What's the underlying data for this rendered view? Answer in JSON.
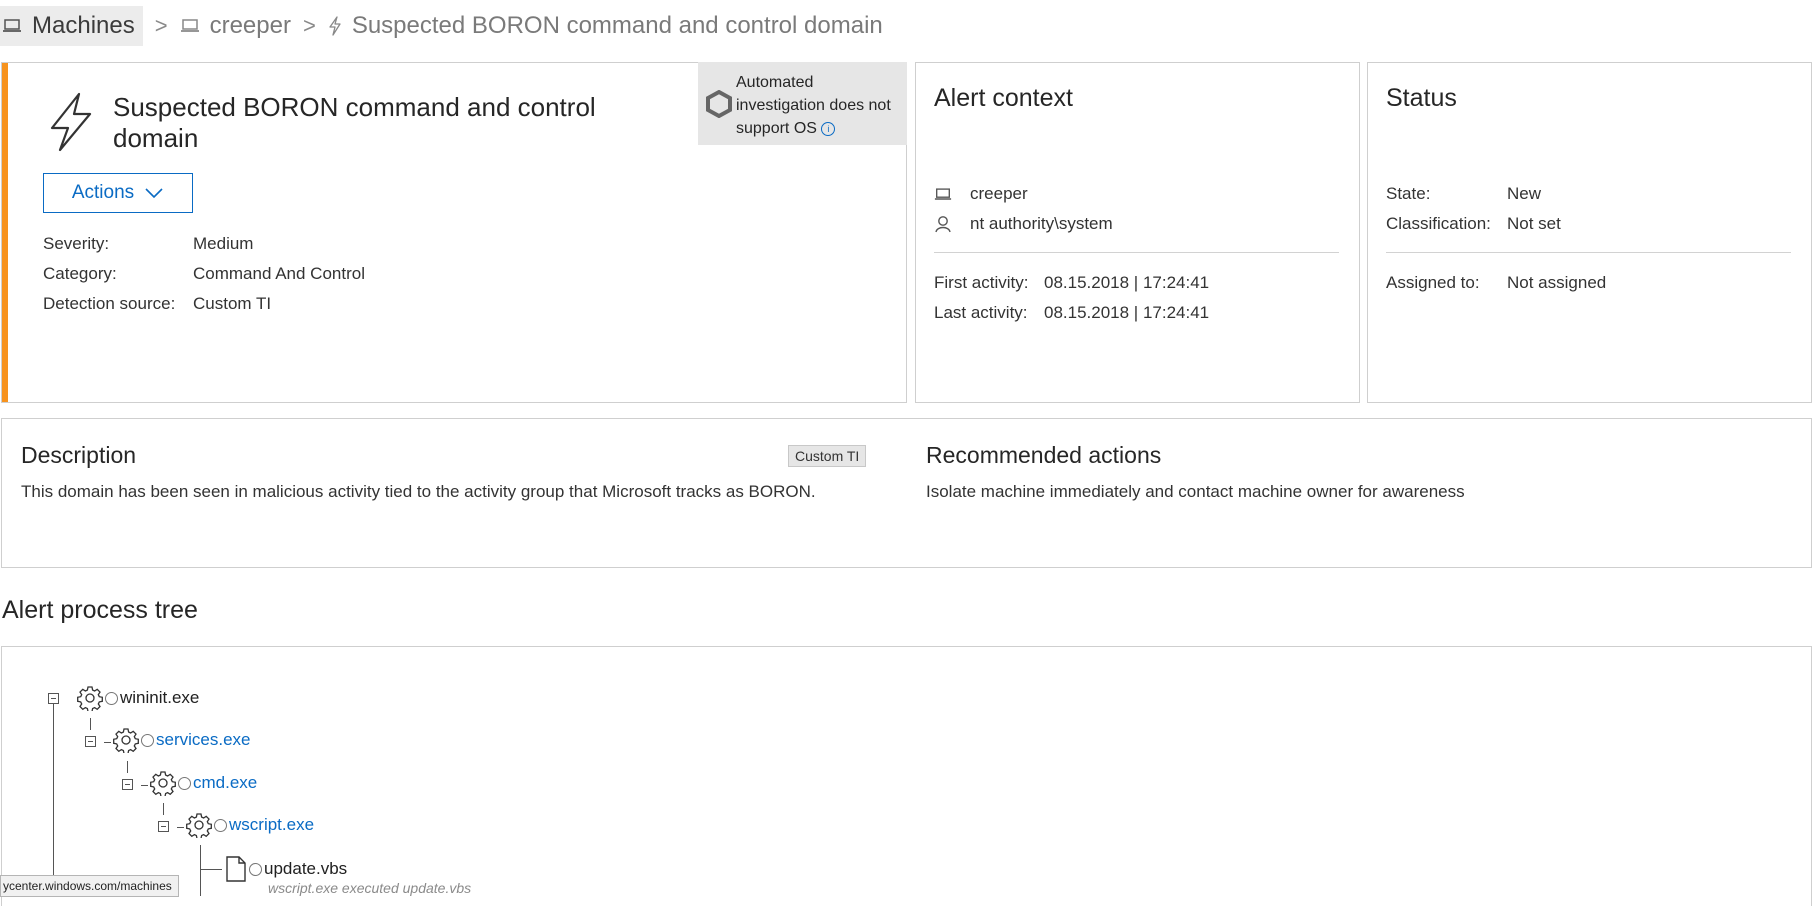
{
  "breadcrumb": {
    "machines": "Machines",
    "machine": "creeper",
    "alert": "Suspected BORON command and control domain"
  },
  "alert": {
    "title": "Suspected BORON command and control domain",
    "actions_label": "Actions",
    "severity_label": "Severity:",
    "severity_value": "Medium",
    "category_label": "Category:",
    "category_value": "Command And Control",
    "source_label": "Detection source:",
    "source_value": "Custom TI",
    "automated_text": "Automated investigation does not support OS",
    "accent_color": "#f7931e"
  },
  "context": {
    "title": "Alert context",
    "machine": "creeper",
    "user": "nt authority\\system",
    "first_label": "First activity:",
    "first_value": "08.15.2018 | 17:24:41",
    "last_label": "Last activity:",
    "last_value": "08.15.2018 | 17:24:41"
  },
  "status": {
    "title": "Status",
    "state_label": "State:",
    "state_value": "New",
    "class_label": "Classification:",
    "class_value": "Not set",
    "assigned_label": "Assigned to:",
    "assigned_value": "Not assigned"
  },
  "description": {
    "title": "Description",
    "tag": "Custom TI",
    "text": "This domain has been seen in malicious activity tied to the activity group that Microsoft tracks as BORON."
  },
  "recommended": {
    "title": "Recommended actions",
    "text": "Isolate machine immediately and contact machine owner for awareness"
  },
  "tree": {
    "title": "Alert process tree",
    "nodes": [
      {
        "name": "wininit.exe",
        "icon": "gear-icon"
      },
      {
        "name": "services.exe",
        "icon": "gear-icon"
      },
      {
        "name": "cmd.exe",
        "icon": "gear-icon"
      },
      {
        "name": "wscript.exe",
        "icon": "gear-icon"
      },
      {
        "name": "update.vbs",
        "icon": "file-icon"
      }
    ],
    "update_desc": "wscript.exe executed update.vbs"
  },
  "status_bar": {
    "url": "ycenter.windows.com/machines"
  },
  "colors": {
    "link": "#0a6bc4",
    "accent": "#f7931e"
  }
}
